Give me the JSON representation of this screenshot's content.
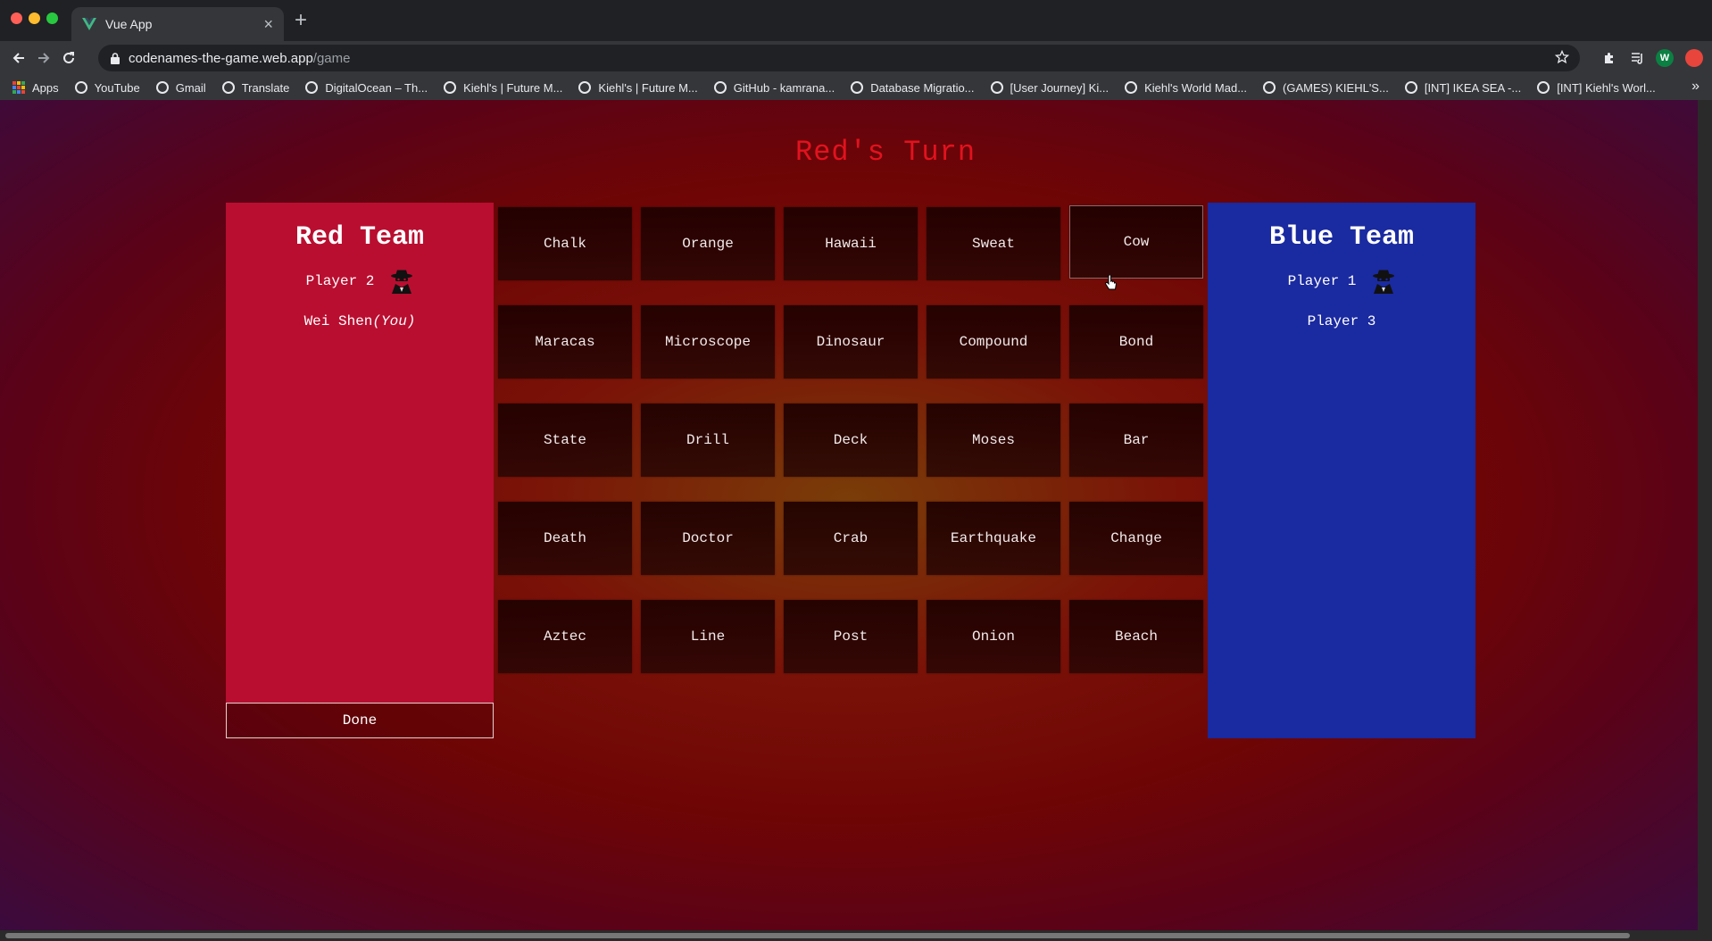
{
  "browser": {
    "tab_title": "Vue App",
    "url_host": "codenames-the-game.web.app",
    "url_path": "/game",
    "profile_initial": "W",
    "bookmarks": [
      "Apps",
      "YouTube",
      "Gmail",
      "Translate",
      "DigitalOcean – Th...",
      "Kiehl's | Future M...",
      "Kiehl's | Future M...",
      "GitHub - kamrana...",
      "Database Migratio...",
      "[User Journey] Ki...",
      "Kiehl's World Mad...",
      "(GAMES) KIEHL'S...",
      "[INT] IKEA SEA -...",
      "[INT] Kiehl's Worl..."
    ]
  },
  "game": {
    "turn_title": "Red's Turn",
    "red_team": {
      "name": "Red Team",
      "spymaster": "Player 2",
      "member_name": "Wei Shen",
      "member_suffix": "(You)",
      "color": "#b90e30"
    },
    "blue_team": {
      "name": "Blue Team",
      "spymaster": "Player 1",
      "member": "Player 3",
      "color": "#1a2aa0"
    },
    "done_label": "Done",
    "words": [
      "Chalk",
      "Orange",
      "Hawaii",
      "Sweat",
      "Cow",
      "Maracas",
      "Microscope",
      "Dinosaur",
      "Compound",
      "Bond",
      "State",
      "Drill",
      "Deck",
      "Moses",
      "Bar",
      "Death",
      "Doctor",
      "Crab",
      "Earthquake",
      "Change",
      "Aztec",
      "Line",
      "Post",
      "Onion",
      "Beach"
    ]
  }
}
